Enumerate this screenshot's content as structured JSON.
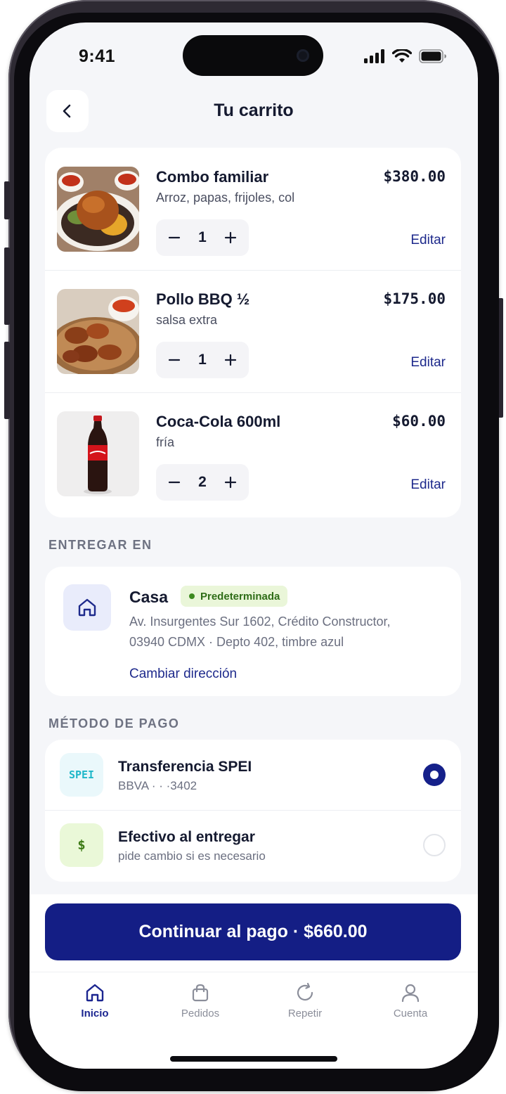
{
  "status_bar": {
    "time": "9:41"
  },
  "header": {
    "title": "Tu carrito"
  },
  "cart": {
    "items": [
      {
        "name": "Combo familiar",
        "description": "Arroz, papas, frijoles, col",
        "price": "$380.00",
        "quantity": "1",
        "edit_label": "Editar",
        "image": "roast-chicken-combo"
      },
      {
        "name": "Pollo BBQ ½",
        "description": "salsa extra",
        "price": "$175.00",
        "quantity": "1",
        "edit_label": "Editar",
        "image": "bbq-chicken-pieces"
      },
      {
        "name": "Coca-Cola 600ml",
        "description": "fría",
        "price": "$60.00",
        "quantity": "2",
        "edit_label": "Editar",
        "image": "coca-cola-bottle"
      }
    ]
  },
  "delivery": {
    "section_label": "ENTREGAR EN",
    "name": "Casa",
    "badge": "Predeterminada",
    "address_line1": "Av. Insurgentes Sur 1602, Crédito Constructor,",
    "address_line2": "03940 CDMX · Depto 402, timbre azul",
    "change_label": "Cambiar dirección"
  },
  "payment": {
    "section_label": "MÉTODO DE PAGO",
    "methods": [
      {
        "icon_text": "SPEI",
        "title": "Transferencia SPEI",
        "subtitle": "BBVA · · ·3402",
        "selected": true,
        "icon_bg": "#eaf8fb",
        "icon_color": "#1fb7c9"
      },
      {
        "icon_text": "$",
        "title": "Efectivo al entregar",
        "subtitle": "pide cambio si es necesario",
        "selected": false,
        "icon_bg": "#eaf8d8",
        "icon_color": "#3d7a16"
      }
    ]
  },
  "cta": {
    "label": "Continuar al pago · $660.00"
  },
  "tab_bar": {
    "tabs": [
      {
        "label": "Inicio",
        "icon": "home-icon",
        "active": true
      },
      {
        "label": "Pedidos",
        "icon": "bag-icon",
        "active": false
      },
      {
        "label": "Repetir",
        "icon": "refresh-icon",
        "active": false
      },
      {
        "label": "Cuenta",
        "icon": "user-icon",
        "active": false
      }
    ]
  },
  "colors": {
    "accent": "#141e85",
    "link": "#1e2a8c",
    "background": "#f5f6f9",
    "badge_bg": "#eaf6d9",
    "badge_text": "#2f6d18"
  }
}
